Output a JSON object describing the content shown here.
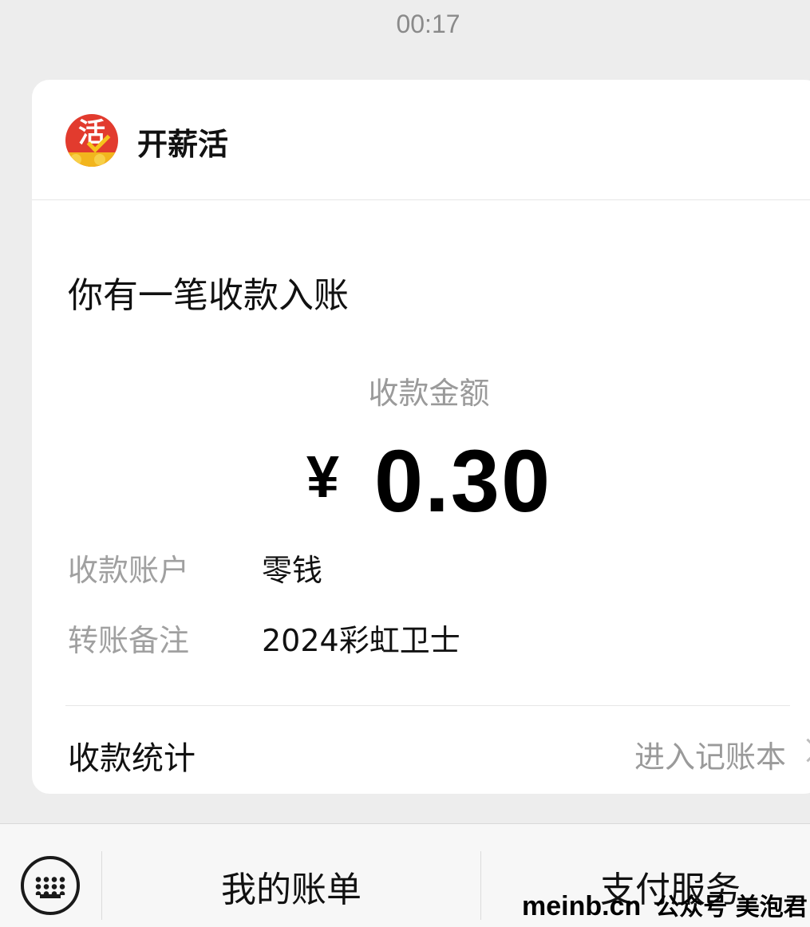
{
  "status_bar": {
    "time": "00:17"
  },
  "card": {
    "sender": {
      "logo_char": "活",
      "name": "开薪活"
    },
    "headline": "你有一笔收款入账",
    "amount": {
      "label": "收款金额",
      "currency": "¥",
      "value": "0.30"
    },
    "details": [
      {
        "label": "收款账户",
        "value": "零钱"
      },
      {
        "label": "转账备注",
        "value": "2024彩虹卫士"
      }
    ],
    "footer": {
      "label": "收款统计",
      "link": "进入记账本"
    }
  },
  "bottom_menu": {
    "keyboard_icon": "keyboard-icon",
    "items": [
      {
        "label": "我的账单"
      },
      {
        "label": "支付服务"
      }
    ]
  },
  "watermark": {
    "site": "meinb.cn",
    "text": "公众号 美泡君"
  },
  "colors": {
    "background": "#ededed",
    "card": "#ffffff",
    "logo_red": "#e23b2e",
    "logo_gold": "#f2b51d"
  }
}
